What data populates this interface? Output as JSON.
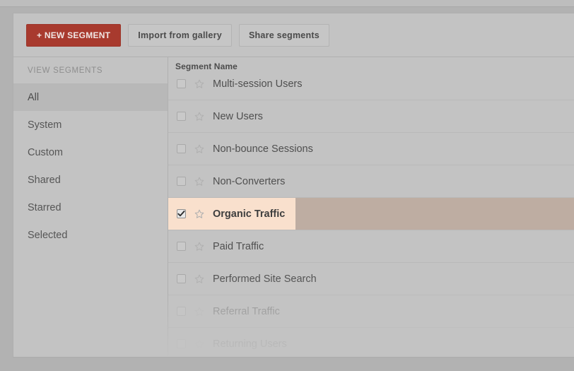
{
  "toolbar": {
    "new_segment_label": "+ NEW SEGMENT",
    "import_label": "Import from gallery",
    "share_label": "Share segments",
    "new_segment_color": "#a83a2e"
  },
  "sidebar": {
    "heading": "VIEW SEGMENTS",
    "items": [
      {
        "label": "All",
        "active": true
      },
      {
        "label": "System",
        "active": false
      },
      {
        "label": "Custom",
        "active": false
      },
      {
        "label": "Shared",
        "active": false
      },
      {
        "label": "Starred",
        "active": false
      },
      {
        "label": "Selected",
        "active": false
      }
    ]
  },
  "list": {
    "column_header": "Segment Name",
    "highlight_color": "#f9e0cd",
    "highlight_row_color": "#beada2",
    "rows": [
      {
        "name": "Multi-session Users",
        "checked": false,
        "starred": false,
        "selected": false,
        "faded": false
      },
      {
        "name": "New Users",
        "checked": false,
        "starred": false,
        "selected": false,
        "faded": false
      },
      {
        "name": "Non-bounce Sessions",
        "checked": false,
        "starred": false,
        "selected": false,
        "faded": false
      },
      {
        "name": "Non-Converters",
        "checked": false,
        "starred": false,
        "selected": false,
        "faded": false
      },
      {
        "name": "Organic Traffic",
        "checked": true,
        "starred": false,
        "selected": true,
        "faded": false
      },
      {
        "name": "Paid Traffic",
        "checked": false,
        "starred": false,
        "selected": false,
        "faded": false
      },
      {
        "name": "Performed Site Search",
        "checked": false,
        "starred": false,
        "selected": false,
        "faded": false
      },
      {
        "name": "Referral Traffic",
        "checked": false,
        "starred": false,
        "selected": false,
        "faded": true
      },
      {
        "name": "Returning Users",
        "checked": false,
        "starred": false,
        "selected": false,
        "faded": true
      }
    ]
  },
  "icons": {
    "checkbox": "checkbox-icon",
    "checkmark": "check-icon",
    "star": "star-outline-icon"
  }
}
